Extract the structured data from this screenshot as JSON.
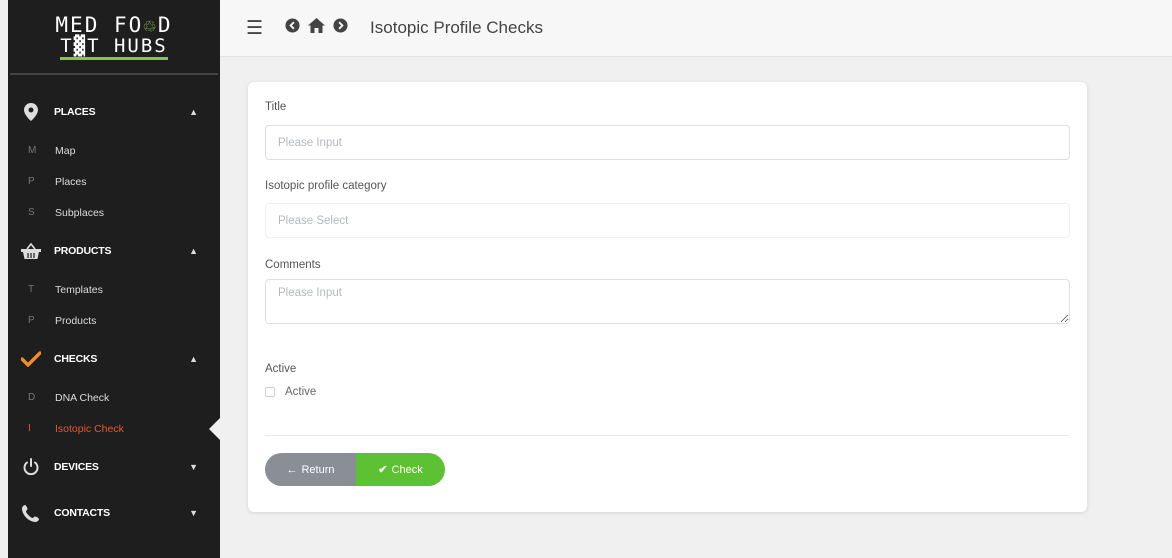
{
  "logo": {
    "line1": "MED FO",
    "line1_leaf": "♲",
    "line1_end": "D",
    "line2": "T▓T HUBS"
  },
  "sidebar": {
    "groups": [
      {
        "label": "PLACES",
        "icon": "map-pin-icon",
        "expanded": true,
        "items": [
          {
            "letter": "M",
            "label": "Map"
          },
          {
            "letter": "P",
            "label": "Places"
          },
          {
            "letter": "S",
            "label": "Subplaces"
          }
        ]
      },
      {
        "label": "PRODUCTS",
        "icon": "basket-icon",
        "expanded": true,
        "items": [
          {
            "letter": "T",
            "label": "Templates"
          },
          {
            "letter": "P",
            "label": "Products"
          }
        ]
      },
      {
        "label": "CHECKS",
        "icon": "check-icon",
        "expanded": true,
        "items": [
          {
            "letter": "D",
            "label": "DNA Check"
          },
          {
            "letter": "I",
            "label": "Isotopic Check"
          }
        ]
      },
      {
        "label": "DEVICES",
        "icon": "power-icon",
        "expanded": false,
        "items": []
      },
      {
        "label": "CONTACTS",
        "icon": "phone-icon",
        "expanded": false,
        "items": []
      }
    ],
    "active_item": "Isotopic Check",
    "accent": "#e8552d"
  },
  "topbar": {
    "title": "Isotopic Profile Checks"
  },
  "form": {
    "title_label": "Title",
    "title_placeholder": "Please Input",
    "category_label": "Isotopic profile category",
    "category_placeholder": "Please Select",
    "comments_label": "Comments",
    "comments_placeholder": "Please Input",
    "active_label": "Active",
    "active_checkbox_label": "Active",
    "active_checked": false
  },
  "buttons": {
    "return_label": "Return",
    "check_label": "Check",
    "check_color": "#5cc133",
    "return_color": "#8a8f96"
  }
}
